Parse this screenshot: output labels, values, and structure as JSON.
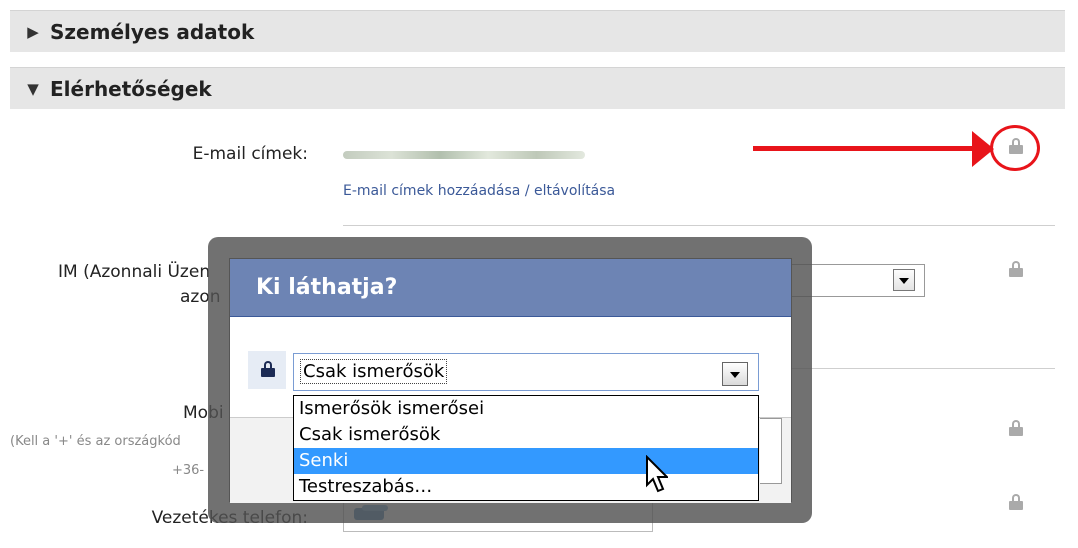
{
  "sections": {
    "personal": {
      "label": "Személyes adatok",
      "state_icon": "triangle-right"
    },
    "contact": {
      "label": "Elérhetőségek",
      "state_icon": "triangle-down"
    }
  },
  "fields": {
    "email_label": "E-mail címek:",
    "email_manage_link": "E-mail címek hozzáadása / eltávolítása",
    "im_label_line1": "IM (Azonnali Üzen",
    "im_label_line2": "azon",
    "mobile_label": "Mobi",
    "mobile_hint_line1": "(Kell a '+' és az országkód",
    "mobile_hint_line2": "+36-",
    "landline_label": "Vezetékes telefon:"
  },
  "dialog": {
    "title": "Ki láthatja?",
    "selected_value": "Csak ismerősök",
    "options": [
      {
        "label": "Ismerősök ismerősei",
        "highlighted": false
      },
      {
        "label": "Csak ismerősök",
        "highlighted": false
      },
      {
        "label": "Senki",
        "highlighted": true
      },
      {
        "label": "Testreszabás…",
        "highlighted": false
      }
    ]
  },
  "icons": {
    "privacy_lock": "lock-icon",
    "annotation": "red-arrow-and-circle",
    "phone": "phone-icon"
  },
  "colors": {
    "dialog_title_bg": "#6d84b4",
    "highlight": "#3399ff",
    "annotation_red": "#e8141a",
    "link": "#3b5998"
  }
}
